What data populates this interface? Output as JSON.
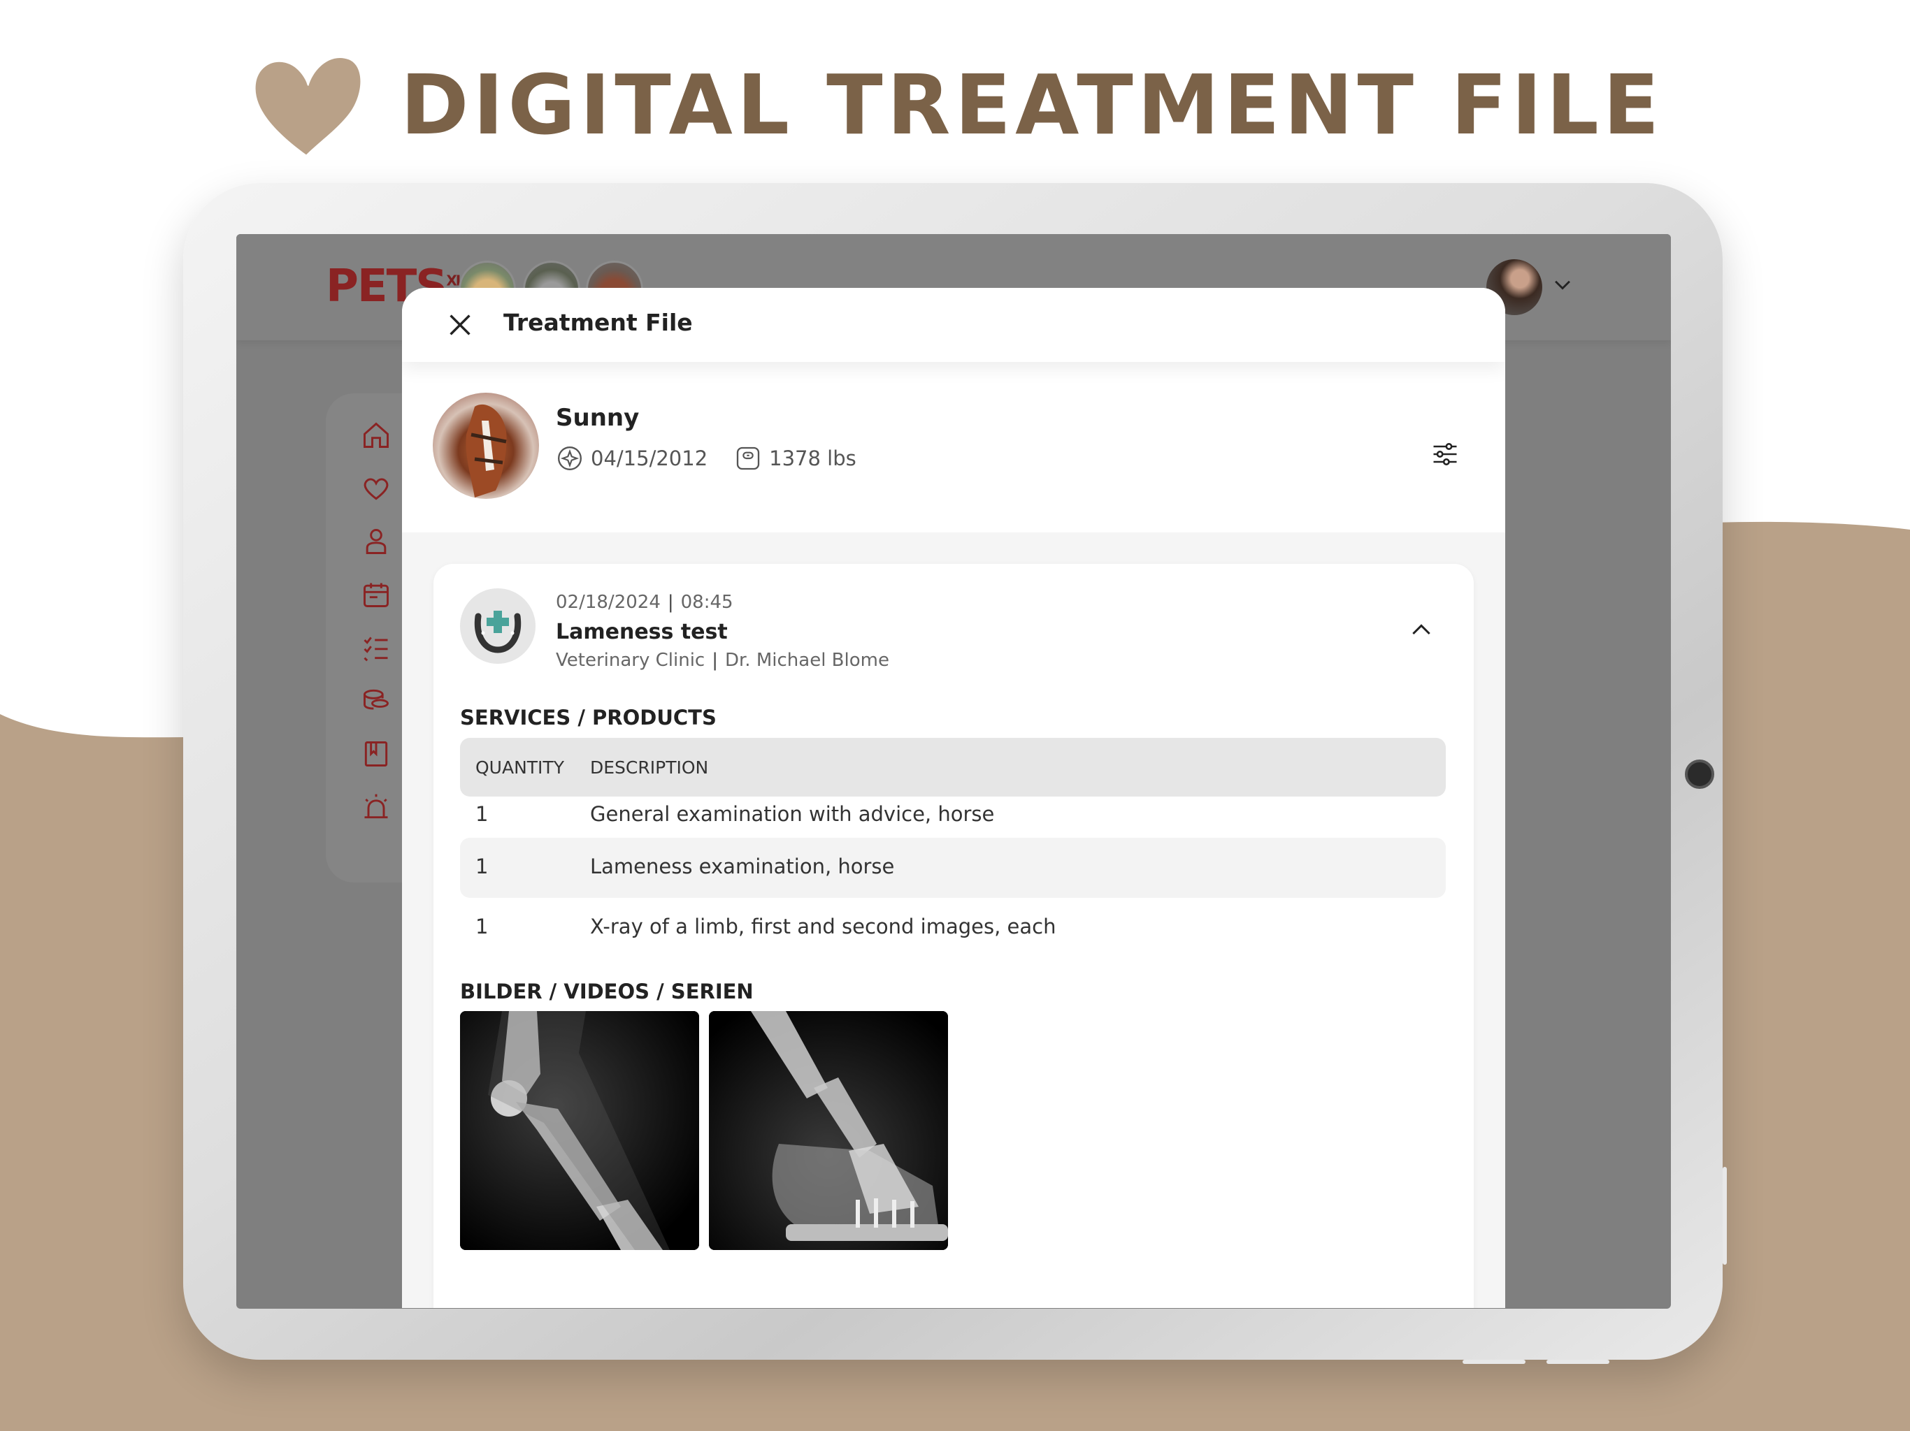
{
  "headline": {
    "text": "DIGITAL TREATMENT FILE",
    "icon": "heart-icon"
  },
  "colors": {
    "brown": "#7b6248",
    "beige": "#b9a188",
    "brand_red": "#8a2323",
    "accent_teal": "#4aa39a"
  },
  "app": {
    "logo": "PETS",
    "logo_sup": "XL",
    "sidebar_icons": [
      "home-icon",
      "heart-icon",
      "vet-icon",
      "calendar-icon",
      "checklist-icon",
      "coins-icon",
      "book-icon",
      "alarm-icon"
    ]
  },
  "modal": {
    "title": "Treatment File",
    "pet": {
      "name": "Sunny",
      "birthdate": "04/15/2012",
      "weight": "1378 lbs"
    },
    "treatment": {
      "date": "02/18/2024",
      "time": "08:45",
      "title": "Lameness test",
      "clinic": "Veterinary Clinic",
      "doctor": "Dr. Michael Blome",
      "services_heading": "SERVICES / PRODUCTS",
      "columns": {
        "quantity": "QUANTITY",
        "description": "DESCRIPTION"
      },
      "rows": [
        {
          "quantity": "1",
          "description": "General examination with advice, horse"
        },
        {
          "quantity": "1",
          "description": "Lameness examination, horse"
        },
        {
          "quantity": "1",
          "description": "X-ray of a limb, first and second images, each"
        }
      ],
      "media_heading": "BILDER / VIDEOS / SERIEN"
    }
  }
}
